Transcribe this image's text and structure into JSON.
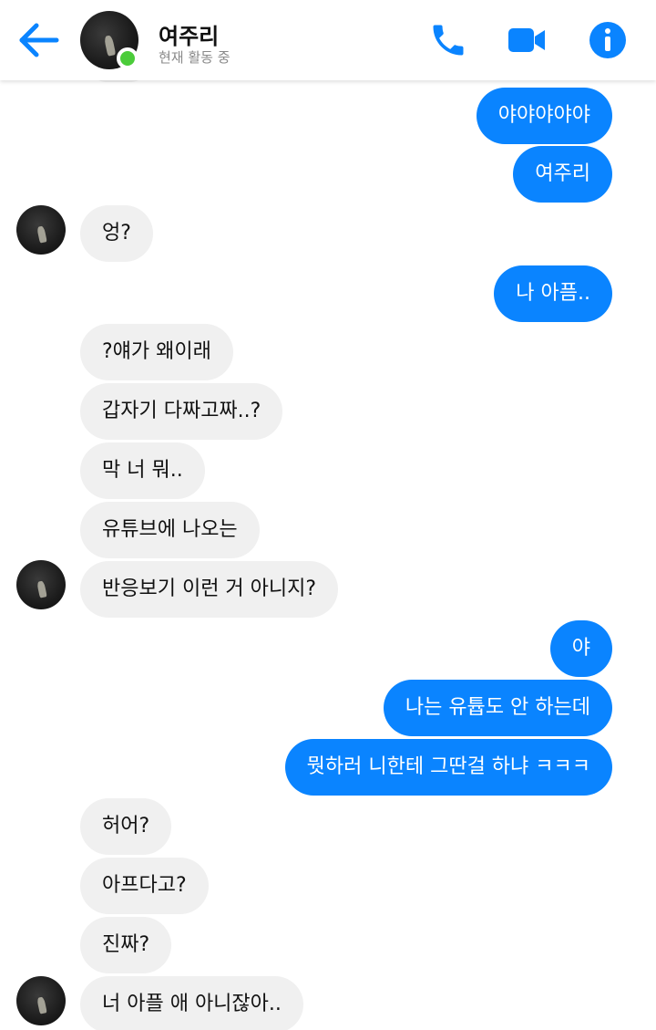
{
  "header": {
    "contact_name": "여주리",
    "status": "현재 활동 중",
    "icons": [
      "back-arrow-icon",
      "phone-icon",
      "video-camera-icon",
      "info-icon"
    ],
    "accent_color": "#0a84ff",
    "online_color": "#4bcc3a"
  },
  "messages": [
    {
      "side": "sent",
      "text": "야야야야야"
    },
    {
      "side": "sent",
      "text": "여주리"
    },
    {
      "side": "received",
      "text": "엉?"
    },
    {
      "side": "sent",
      "text": "나 아픔.."
    },
    {
      "side": "received",
      "text": "?얘가 왜이래"
    },
    {
      "side": "received",
      "text": "갑자기 다짜고짜..?"
    },
    {
      "side": "received",
      "text": "막 너 뭐.."
    },
    {
      "side": "received",
      "text": "유튜브에 나오는"
    },
    {
      "side": "received",
      "text": "반응보기 이런 거 아니지?"
    },
    {
      "side": "sent",
      "text": "야"
    },
    {
      "side": "sent",
      "text": "나는 유튭도 안 하는데"
    },
    {
      "side": "sent",
      "text": "뭣하러 니한테 그딴걸 하냐 ㅋㅋㅋ"
    },
    {
      "side": "received",
      "text": "허어?"
    },
    {
      "side": "received",
      "text": "아프다고?"
    },
    {
      "side": "received",
      "text": "진짜?"
    },
    {
      "side": "received",
      "text": "너 아플 애 아니잖아.."
    }
  ],
  "colors": {
    "sent_bubble": "#0a84ff",
    "received_bubble": "#f0f0f0"
  }
}
